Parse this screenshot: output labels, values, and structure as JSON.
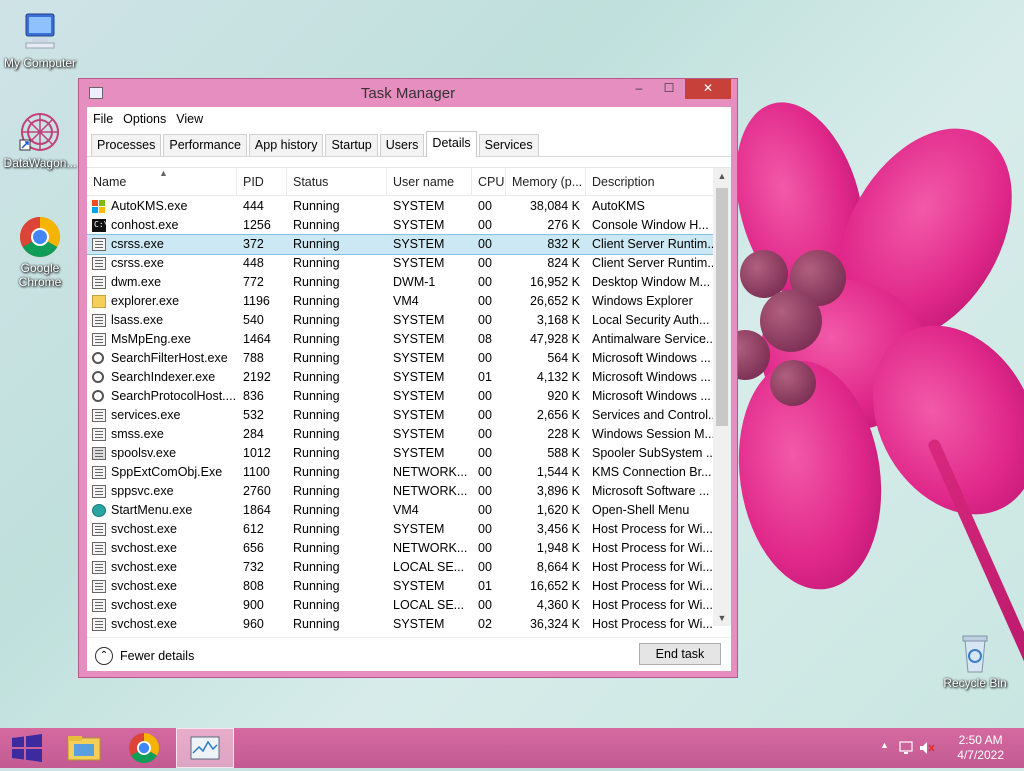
{
  "desktop": {
    "icons": [
      {
        "label": "My Computer",
        "icon": "computer-icon"
      },
      {
        "label": "DataWagon...",
        "icon": "datawagon-icon"
      },
      {
        "label": "Google Chrome",
        "icon": "chrome-icon"
      },
      {
        "label": "Recycle Bin",
        "icon": "recycle-bin-icon"
      }
    ]
  },
  "window": {
    "title": "Task Manager",
    "controls": {
      "minimize": "–",
      "maximize": "☐",
      "close": "✕"
    },
    "menu": [
      "File",
      "Options",
      "View"
    ],
    "tabs": [
      "Processes",
      "Performance",
      "App history",
      "Startup",
      "Users",
      "Details",
      "Services"
    ],
    "active_tab": "Details",
    "columns": {
      "name": "Name",
      "pid": "PID",
      "status": "Status",
      "user": "User name",
      "cpu": "CPU",
      "memory": "Memory (p...",
      "description": "Description"
    },
    "rows": [
      {
        "name": "AutoKMS.exe",
        "pid": "444",
        "status": "Running",
        "user": "SYSTEM",
        "cpu": "00",
        "memory": "38,084 K",
        "description": "AutoKMS",
        "icon": "ms"
      },
      {
        "name": "conhost.exe",
        "pid": "1256",
        "status": "Running",
        "user": "SYSTEM",
        "cpu": "00",
        "memory": "276 K",
        "description": "Console Window H...",
        "icon": "cmd"
      },
      {
        "name": "csrss.exe",
        "pid": "372",
        "status": "Running",
        "user": "SYSTEM",
        "cpu": "00",
        "memory": "832 K",
        "description": "Client Server Runtim...",
        "icon": "app",
        "selected": true
      },
      {
        "name": "csrss.exe",
        "pid": "448",
        "status": "Running",
        "user": "SYSTEM",
        "cpu": "00",
        "memory": "824 K",
        "description": "Client Server Runtim...",
        "icon": "app"
      },
      {
        "name": "dwm.exe",
        "pid": "772",
        "status": "Running",
        "user": "DWM-1",
        "cpu": "00",
        "memory": "16,952 K",
        "description": "Desktop Window M...",
        "icon": "app"
      },
      {
        "name": "explorer.exe",
        "pid": "1196",
        "status": "Running",
        "user": "VM4",
        "cpu": "00",
        "memory": "26,652 K",
        "description": "Windows Explorer",
        "icon": "folder"
      },
      {
        "name": "lsass.exe",
        "pid": "540",
        "status": "Running",
        "user": "SYSTEM",
        "cpu": "00",
        "memory": "3,168 K",
        "description": "Local Security Auth...",
        "icon": "app"
      },
      {
        "name": "MsMpEng.exe",
        "pid": "1464",
        "status": "Running",
        "user": "SYSTEM",
        "cpu": "08",
        "memory": "47,928 K",
        "description": "Antimalware Service...",
        "icon": "app"
      },
      {
        "name": "SearchFilterHost.exe",
        "pid": "788",
        "status": "Running",
        "user": "SYSTEM",
        "cpu": "00",
        "memory": "564 K",
        "description": "Microsoft Windows ...",
        "icon": "search"
      },
      {
        "name": "SearchIndexer.exe",
        "pid": "2192",
        "status": "Running",
        "user": "SYSTEM",
        "cpu": "01",
        "memory": "4,132 K",
        "description": "Microsoft Windows ...",
        "icon": "search"
      },
      {
        "name": "SearchProtocolHost....",
        "pid": "836",
        "status": "Running",
        "user": "SYSTEM",
        "cpu": "00",
        "memory": "920 K",
        "description": "Microsoft Windows ...",
        "icon": "search"
      },
      {
        "name": "services.exe",
        "pid": "532",
        "status": "Running",
        "user": "SYSTEM",
        "cpu": "00",
        "memory": "2,656 K",
        "description": "Services and Control...",
        "icon": "app"
      },
      {
        "name": "smss.exe",
        "pid": "284",
        "status": "Running",
        "user": "SYSTEM",
        "cpu": "00",
        "memory": "228 K",
        "description": "Windows Session M...",
        "icon": "app"
      },
      {
        "name": "spoolsv.exe",
        "pid": "1012",
        "status": "Running",
        "user": "SYSTEM",
        "cpu": "00",
        "memory": "588 K",
        "description": "Spooler SubSystem ...",
        "icon": "printer"
      },
      {
        "name": "SppExtComObj.Exe",
        "pid": "1100",
        "status": "Running",
        "user": "NETWORK...",
        "cpu": "00",
        "memory": "1,544 K",
        "description": "KMS Connection Br...",
        "icon": "app"
      },
      {
        "name": "sppsvc.exe",
        "pid": "2760",
        "status": "Running",
        "user": "NETWORK...",
        "cpu": "00",
        "memory": "3,896 K",
        "description": "Microsoft Software ...",
        "icon": "app"
      },
      {
        "name": "StartMenu.exe",
        "pid": "1864",
        "status": "Running",
        "user": "VM4",
        "cpu": "00",
        "memory": "1,620 K",
        "description": "Open-Shell Menu",
        "icon": "globe"
      },
      {
        "name": "svchost.exe",
        "pid": "612",
        "status": "Running",
        "user": "SYSTEM",
        "cpu": "00",
        "memory": "3,456 K",
        "description": "Host Process for Wi...",
        "icon": "app"
      },
      {
        "name": "svchost.exe",
        "pid": "656",
        "status": "Running",
        "user": "NETWORK...",
        "cpu": "00",
        "memory": "1,948 K",
        "description": "Host Process for Wi...",
        "icon": "app"
      },
      {
        "name": "svchost.exe",
        "pid": "732",
        "status": "Running",
        "user": "LOCAL SE...",
        "cpu": "00",
        "memory": "8,664 K",
        "description": "Host Process for Wi...",
        "icon": "app"
      },
      {
        "name": "svchost.exe",
        "pid": "808",
        "status": "Running",
        "user": "SYSTEM",
        "cpu": "01",
        "memory": "16,652 K",
        "description": "Host Process for Wi...",
        "icon": "app"
      },
      {
        "name": "svchost.exe",
        "pid": "900",
        "status": "Running",
        "user": "LOCAL SE...",
        "cpu": "00",
        "memory": "4,360 K",
        "description": "Host Process for Wi...",
        "icon": "app"
      },
      {
        "name": "svchost.exe",
        "pid": "960",
        "status": "Running",
        "user": "SYSTEM",
        "cpu": "02",
        "memory": "36,324 K",
        "description": "Host Process for Wi...",
        "icon": "app"
      }
    ],
    "footer": {
      "fewer_details": "Fewer details",
      "end_task": "End task"
    }
  },
  "taskbar": {
    "items": [
      "start-icon",
      "file-explorer-icon",
      "chrome-icon",
      "task-manager-icon"
    ],
    "clock": {
      "time": "2:50 AM",
      "date": "4/7/2022"
    }
  },
  "colors": {
    "window_frame": "#e68ec0",
    "close_button": "#c7403a",
    "selected_row": "#cce8f4",
    "taskbar": "#c95f96"
  }
}
